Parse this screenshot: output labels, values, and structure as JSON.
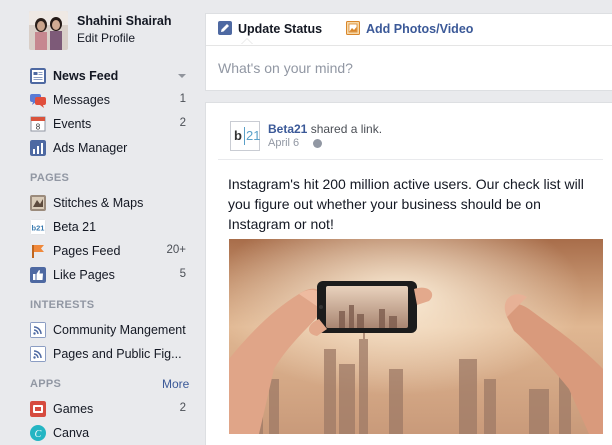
{
  "profile": {
    "name": "Shahini Shairah",
    "edit_label": "Edit Profile"
  },
  "sidebar": {
    "favorites": [
      {
        "label": "News Feed",
        "icon": "news-feed-icon",
        "count": ""
      },
      {
        "label": "Messages",
        "icon": "messages-icon",
        "count": "1"
      },
      {
        "label": "Events",
        "icon": "events-icon",
        "count": "2",
        "icon_text": "8"
      },
      {
        "label": "Ads Manager",
        "icon": "ads-manager-icon",
        "count": ""
      }
    ],
    "pages_title": "PAGES",
    "pages": [
      {
        "label": "Stitches & Maps",
        "icon": "stitches-maps-icon",
        "count": ""
      },
      {
        "label": "Beta 21",
        "icon": "beta21-icon",
        "count": "",
        "icon_text": "b21"
      },
      {
        "label": "Pages Feed",
        "icon": "pages-feed-icon",
        "count": "20+"
      },
      {
        "label": "Like Pages",
        "icon": "like-icon",
        "count": "5"
      }
    ],
    "interests_title": "INTERESTS",
    "interests": [
      {
        "label": "Community Mangement",
        "icon": "feed-list-icon",
        "count": ""
      },
      {
        "label": "Pages and Public Fig...",
        "icon": "feed-list-icon",
        "count": ""
      }
    ],
    "apps_title": "APPS",
    "apps_more": "More",
    "apps": [
      {
        "label": "Games",
        "icon": "games-icon",
        "count": "2"
      },
      {
        "label": "Canva",
        "icon": "canva-icon",
        "count": "",
        "icon_text": "C"
      }
    ]
  },
  "composer": {
    "tab_update": "Update Status",
    "tab_photo": "Add Photos/Video",
    "placeholder": "What's on your mind?"
  },
  "post": {
    "avatar_left": "b",
    "avatar_right": "21",
    "author": "Beta21",
    "action": " shared a link.",
    "date": "April 6",
    "text": "Instagram's hit 200 million active users. Our check list will you figure out whether your business should be on Instagram or not!"
  },
  "colors": {
    "brand_blue": "#3b5998",
    "sidebar_bg": "#e9eaed",
    "muted_text": "#9197a3"
  }
}
